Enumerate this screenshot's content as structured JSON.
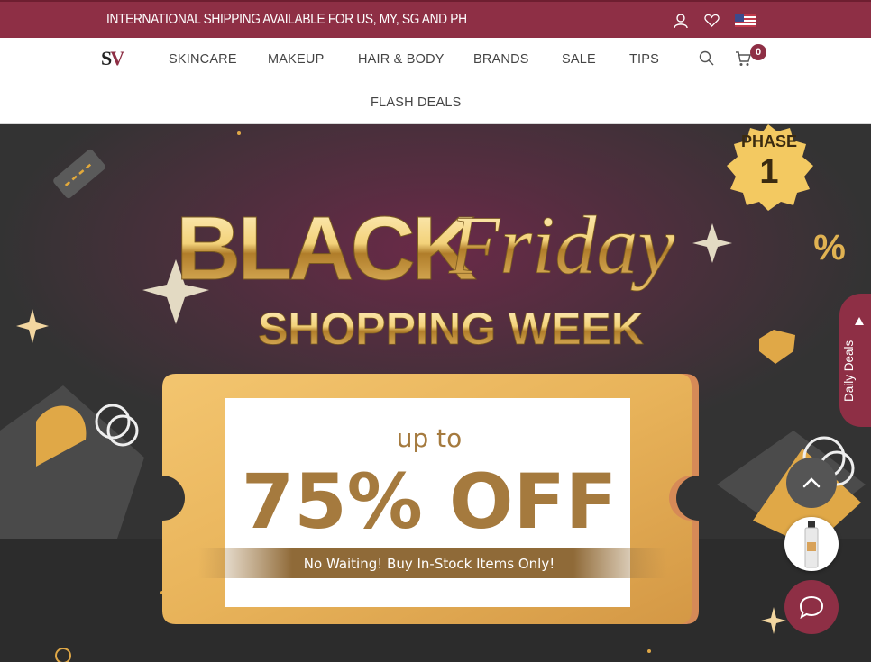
{
  "topbar": {
    "shipping_text": "INTERNATIONAL SHIPPING AVAILABLE FOR US, MY, SG AND PH",
    "icons": [
      "user-icon",
      "heart-icon",
      "us-flag-icon"
    ]
  },
  "nav": {
    "logo_s": "S",
    "logo_v": "V",
    "items": [
      "SKINCARE",
      "MAKEUP",
      "HAIR & BODY",
      "BRANDS",
      "SALE",
      "TIPS",
      "FLASH DEALS"
    ],
    "cart_count": "0"
  },
  "hero": {
    "phase_label": "PHASE",
    "phase_number": "1",
    "title_black": "BLACK",
    "title_friday": "Friday",
    "subtitle": "SHOPPING WEEK",
    "ticket_upto": "up to",
    "ticket_discount": "75% OFF",
    "ticket_note": "No Waiting! Buy In-Stock Items Only!",
    "percent_symbol": "%"
  },
  "floating": {
    "daily_deals": "Daily Deals"
  },
  "colors": {
    "brand": "#8e2f45",
    "gold": "#c9963f",
    "hero_bg": "#333333"
  }
}
